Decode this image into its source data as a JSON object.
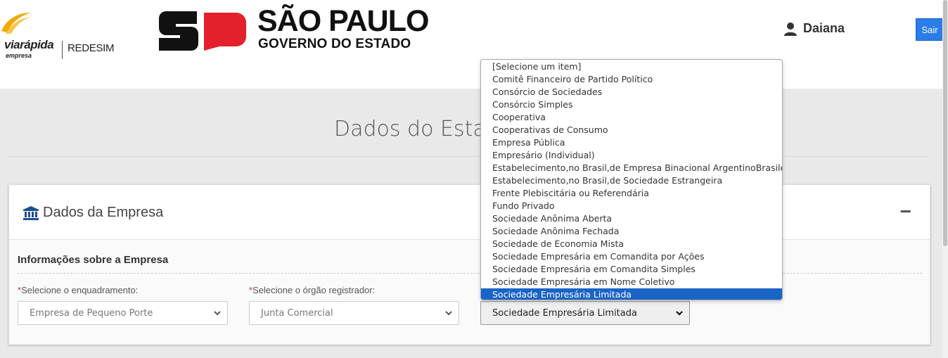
{
  "header": {
    "brand_via": "viarápida",
    "brand_via_sub": "empresa",
    "brand_redesim": "REDESIM",
    "gov_title": "SÃO PAULO",
    "gov_subtitle": "GOVERNO DO ESTADO",
    "user_name": "Daiana",
    "logout_label": "Sair",
    "colors": {
      "logout_bg": "#2b7de9",
      "sp_red": "#e3202b",
      "brand_gold": "#f2a900"
    }
  },
  "main": {
    "page_title": "Dados do Esta",
    "panel": {
      "title": "Dados da Empresa",
      "collapse_label": "−",
      "section_title": "Informações sobre a Empresa",
      "fields": [
        {
          "required_mark": "*",
          "label": "Selecione o enquadramento:",
          "value": "Empresa de Pequeno Porte"
        },
        {
          "required_mark": "*",
          "label": "Selecione o órgão registrador:",
          "value": "Junta Comercial"
        },
        {
          "required_mark": "",
          "label": "",
          "value": "Sociedade Empresária Limitada"
        }
      ]
    }
  },
  "dropdown": {
    "options": [
      "[Selecione um item]",
      "Comitê Financeiro de Partido Político",
      "Consórcio de Sociedades",
      "Consórcio Simples",
      "Cooperativa",
      "Cooperativas de Consumo",
      "Empresa Pública",
      "Empresário (Individual)",
      "Estabelecimento,no Brasil,de Empresa Binacional ArgentinoBrasileira",
      "Estabelecimento,no Brasil,de Sociedade Estrangeira",
      "Frente Plebiscitária ou Referendária",
      "Fundo Privado",
      "Sociedade Anônima Aberta",
      "Sociedade Anônima Fechada",
      "Sociedade de Economia Mista",
      "Sociedade Empresária em Comandita por Ações",
      "Sociedade Empresária em Comandita Simples",
      "Sociedade Empresária em Nome Coletivo",
      "Sociedade Empresária Limitada"
    ],
    "selected_index": 18
  }
}
